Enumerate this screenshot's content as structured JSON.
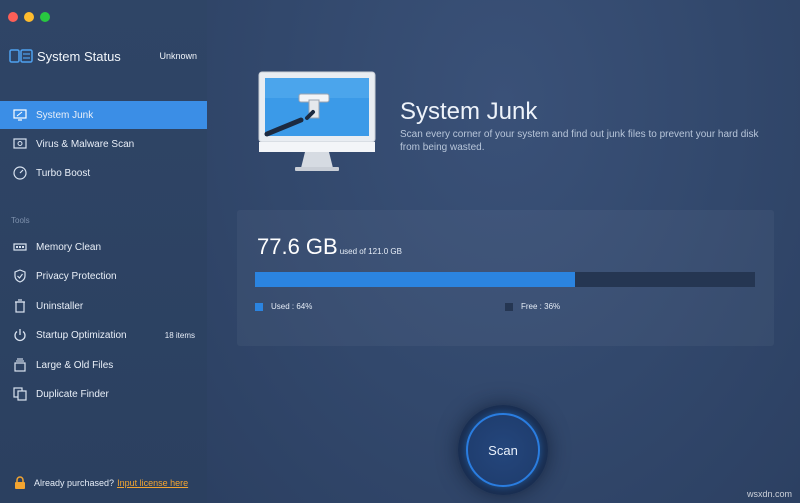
{
  "app": {
    "status_title": "System Status",
    "status_value": "Unknown"
  },
  "sidebar": {
    "items": [
      {
        "label": "System Junk",
        "icon": "monitor-icon",
        "active": true
      },
      {
        "label": "Virus & Malware Scan",
        "icon": "shield-scan-icon"
      },
      {
        "label": "Turbo Boost",
        "icon": "speedometer-icon"
      }
    ],
    "tools_label": "Tools",
    "tools": [
      {
        "label": "Memory Clean",
        "icon": "memory-chip-icon"
      },
      {
        "label": "Privacy Protection",
        "icon": "privacy-shield-icon"
      },
      {
        "label": "Uninstaller",
        "icon": "trash-icon"
      },
      {
        "label": "Startup Optimization",
        "icon": "power-icon",
        "count": "18 items"
      },
      {
        "label": "Large & Old Files",
        "icon": "files-stack-icon"
      },
      {
        "label": "Duplicate Finder",
        "icon": "duplicate-files-icon"
      }
    ],
    "license_text": "Already purchased?",
    "license_link": "Input license here"
  },
  "main": {
    "title": "System Junk",
    "description": "Scan every corner of your system and find out junk files to prevent your hard disk from being wasted.",
    "storage": {
      "used_amount": "77.6 GB",
      "used_of": "used of 121.0 GB",
      "used_fraction": 0.64,
      "used_label": "Used : 64%",
      "free_label": "Free : 36%"
    },
    "scan_label": "Scan"
  },
  "colors": {
    "accent": "#3b8ee6",
    "bar_used": "#2b84e0",
    "bar_free": "#253652",
    "link": "#f3a531"
  },
  "watermark": "wsxdn.com"
}
